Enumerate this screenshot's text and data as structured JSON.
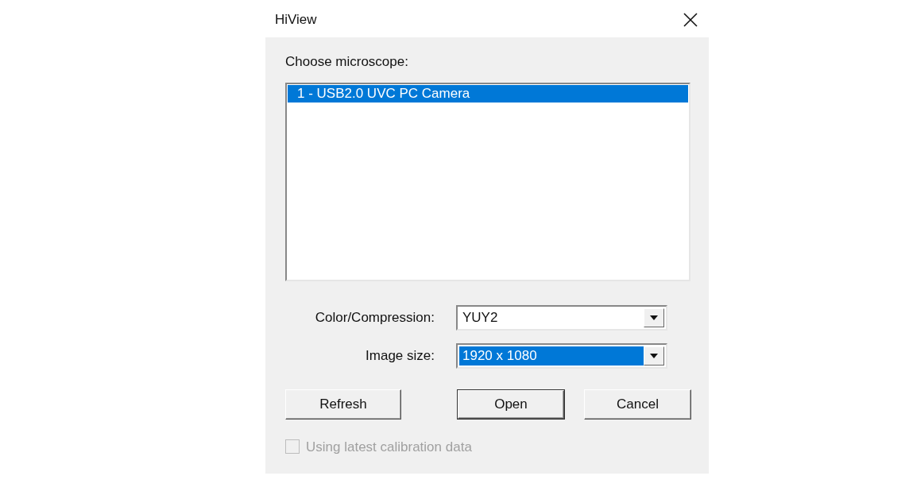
{
  "window": {
    "title": "HiView"
  },
  "microscope_list": {
    "label": "Choose microscope:",
    "items": [
      {
        "text": "1 - USB2.0 UVC PC Camera",
        "selected": true
      }
    ]
  },
  "fields": [
    {
      "label": "Color/Compression:",
      "value": "YUY2",
      "focused": false
    },
    {
      "label": "Image size:",
      "value": "1920 x 1080",
      "focused": true
    }
  ],
  "buttons": [
    {
      "label": "Refresh",
      "default": false
    },
    {
      "label": "Open",
      "default": true
    },
    {
      "label": "Cancel",
      "default": false
    }
  ],
  "calibration_checkbox": {
    "label": "Using latest calibration data",
    "checked": false,
    "disabled": true
  }
}
